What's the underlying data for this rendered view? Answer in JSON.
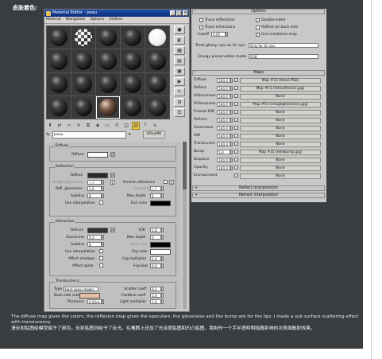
{
  "heading": "皮肤着色:",
  "window": {
    "title": "Material Editor - peau",
    "menus": [
      "Material",
      "Navigation",
      "Options",
      "Utilities"
    ]
  },
  "sample_slots": [
    "dark",
    "checker",
    "dark",
    "dark",
    "white",
    "dark",
    "dark",
    "dark",
    "dark",
    "dark",
    "dark",
    "dark",
    "dark",
    "dark",
    "dark",
    "dark",
    "dark",
    "skin",
    "dark",
    "dark"
  ],
  "material_name": "peau",
  "material_type": "VRayMtl",
  "diffuse": {
    "group": "Diffuse",
    "label": "Diffuse",
    "color": "#ffffff",
    "map_btn": "M"
  },
  "reflection": {
    "group": "Reflection",
    "reflect_label": "Reflect",
    "reflect_color": "#2a2a2a",
    "map_btn": "M",
    "hilight_label": "Hilight glossiness",
    "hilight_value": "1.0",
    "hilight_lock": "L",
    "fresnel_label": "Fresnel reflections",
    "fresnel_ior_label": "Fresnel IOR",
    "fresnel_ior_value": "1.6",
    "fresnel_ior_lock": "L",
    "refl_gloss_label": "Refl. glossiness",
    "refl_gloss_value": "1.0",
    "max_depth_label": "Max depth",
    "max_depth_value": "5",
    "subdivs_label": "Subdivs",
    "subdivs_value": "8",
    "use_interp_label": "Use interpolation",
    "exit_color_label": "Exit color",
    "exit_color": "#000000"
  },
  "refraction": {
    "group": "Refraction",
    "refract_label": "Refract",
    "refract_color": "#333333",
    "map_btn": "M",
    "ior_label": "IOR",
    "ior_value": "1.6",
    "gloss_label": "Glossiness",
    "gloss_value": "0.2",
    "max_depth_label": "Max depth",
    "max_depth_value": "5",
    "subdivs_label": "Subdivs",
    "subdivs_value": "8",
    "exit_color_label": "Exit color",
    "exit_color": "#000000",
    "use_interp_label": "Use interpolation",
    "fog_color_label": "Fog color",
    "fog_color": "#ffffff",
    "affect_shadows_label": "Affect shadows",
    "fog_mult_label": "Fog multiplier",
    "fog_mult_value": "1.0",
    "affect_alpha_label": "Affect alpha",
    "fog_bias_label": "Fog bias",
    "fog_bias_value": "0.0"
  },
  "translucency": {
    "group": "Translucency",
    "type_label": "Type",
    "type_value": "Hard (wax) model",
    "scatter_label": "Scatter coeff",
    "scatter_value": "0.2",
    "back_color_label": "Back-side color",
    "back_color": "#e8bfa3",
    "fwd_label": "Fwd/bck coeff",
    "fwd_value": "1.0",
    "thickness_label": "Thickness",
    "thickness_value": "0.01m",
    "light_mult_label": "Light multiplier",
    "light_mult_value": "1.0"
  },
  "options": {
    "title": "Options",
    "trace_reflections": "Trace reflections",
    "trace_refractions": "Trace refractions",
    "cutoff_label": "Cutoff",
    "cutoff_value": "0.01",
    "double_sided": "Double-sided",
    "reflect_back": "Reflect on back side",
    "use_irradiance": "Use irradiance map",
    "treat_glossy_label": "Treat glossy rays as GI rays",
    "treat_glossy_value": "Only for GI rays",
    "energy_label": "Energy preservation mode",
    "energy_value": "RGB"
  },
  "maps": {
    "title": "Maps",
    "rows": [
      {
        "label": "Diffuse",
        "value": "100.0",
        "map": "Map #33 (tete2.PSD)"
      },
      {
        "label": "Reflect",
        "value": "100.0",
        "map": "Map #41 (tetereflexion.jpg)"
      },
      {
        "label": "HGlossiness",
        "value": "100.0",
        "map": "None"
      },
      {
        "label": "RGlossiness",
        "value": "100.0",
        "map": "Map #43 (visageglossiness.jpg)"
      },
      {
        "label": "Fresnel IOR",
        "value": "100.0",
        "map": "None"
      },
      {
        "label": "Refract",
        "value": "100.0",
        "map": "None"
      },
      {
        "label": "Glossiness",
        "value": "100.0",
        "map": "None"
      },
      {
        "label": "IOR",
        "value": "100.0",
        "map": "None"
      },
      {
        "label": "Translucent",
        "value": "100.0",
        "map": "None"
      },
      {
        "label": "Bump",
        "value": "5.0",
        "map": "Map #35 (tetebump.jpg)"
      },
      {
        "label": "Displace",
        "value": "100.0",
        "map": "None"
      },
      {
        "label": "Opacity",
        "value": "100.0",
        "map": "None"
      },
      {
        "label": "Environment",
        "value": "",
        "map": "None"
      }
    ]
  },
  "reflect_interp": "Reflect interpolation",
  "refract_interp": "Refract interpolation",
  "caption_en": "The diffuse map gives the colors, the reflexion map gives the speculars, the glossiness and the bump are for the lips. I made a sub surface scattering effect with translucency.",
  "caption_cn": "漫反射贴图给模型赋予了颜色。反射贴图则给予了反光。在嘴唇上还加了光泽度贴图和凹凸贴图。我制作一个手半透明明暗器影响的次表面散射效果。"
}
